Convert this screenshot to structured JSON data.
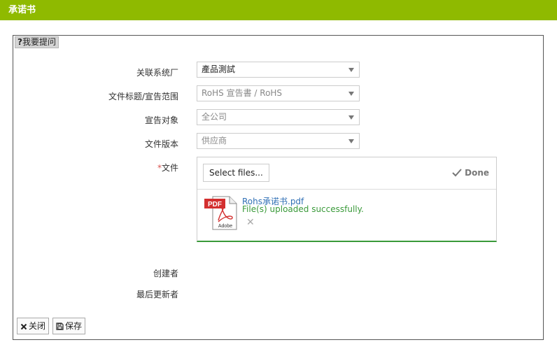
{
  "window": {
    "title": "承诺书"
  },
  "help": {
    "mark": "?",
    "label": "我要提问"
  },
  "form": {
    "supplier_label": "关联系统厂",
    "supplier_value": "產品測試",
    "doc_title_label": "文件标题/宣告范围",
    "doc_title_value": "RoHS 宣告書 / RoHS",
    "target_label": "宣告对象",
    "target_value": "全公司",
    "version_label": "文件版本",
    "version_value": "供应商",
    "file_label": "文件",
    "file_required_mark": "*",
    "creator_label": "创建者",
    "updater_label": "最后更新者"
  },
  "upload": {
    "select_button": "Select files...",
    "done_label": "Done",
    "file_name": "Rohs承诺书.pdf",
    "file_status": "File(s) uploaded successfully.",
    "remove_glyph": "✕",
    "pdf_badge": "PDF",
    "pdf_brand": "Adobe"
  },
  "buttons": {
    "close_label": "关闭",
    "save_label": "保存"
  },
  "colors": {
    "titlebar": "#8fba00",
    "success": "#3a9a3a",
    "link": "#2f6fb5",
    "pdf_red": "#d32f2f"
  }
}
